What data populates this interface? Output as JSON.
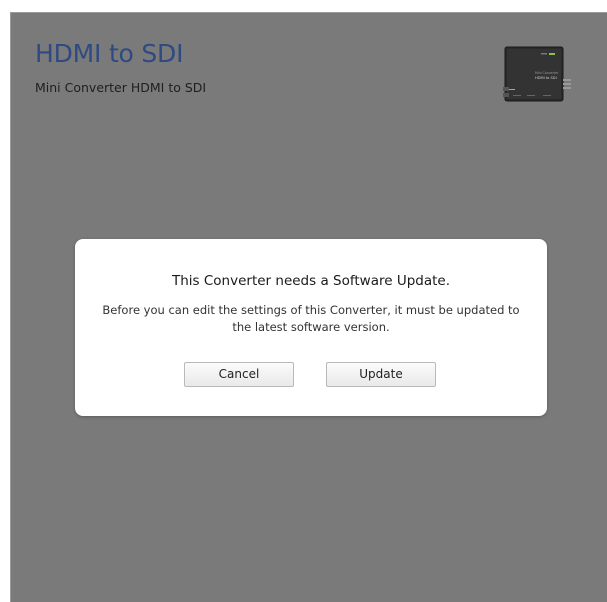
{
  "header": {
    "title": "HDMI to SDI",
    "subtitle": "Mini Converter HDMI to SDI"
  },
  "device_image": {
    "icon": "mini-converter-device-icon",
    "label_line1": "Mini Converter",
    "label_line2": "HDMI to SDI"
  },
  "dialog": {
    "title": "This Converter needs a Software Update.",
    "message": "Before you can edit the settings of this Converter, it must be updated to the latest software version.",
    "cancel_label": "Cancel",
    "update_label": "Update"
  },
  "colors": {
    "background": "#7a7a7a",
    "title": "#2f4a82",
    "dialog": "#ffffff"
  }
}
